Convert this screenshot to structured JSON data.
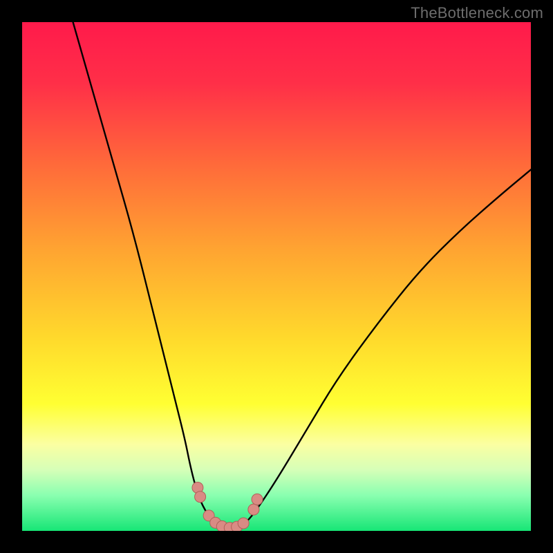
{
  "watermark": "TheBottleneck.com",
  "colors": {
    "frame": "#000000",
    "gradient_stops": [
      {
        "offset": 0.0,
        "color": "#ff1a4b"
      },
      {
        "offset": 0.12,
        "color": "#ff2f48"
      },
      {
        "offset": 0.28,
        "color": "#ff6a3a"
      },
      {
        "offset": 0.45,
        "color": "#ffa531"
      },
      {
        "offset": 0.62,
        "color": "#ffd92c"
      },
      {
        "offset": 0.75,
        "color": "#ffff32"
      },
      {
        "offset": 0.83,
        "color": "#fbffa2"
      },
      {
        "offset": 0.88,
        "color": "#d6ffb8"
      },
      {
        "offset": 0.93,
        "color": "#8affb0"
      },
      {
        "offset": 1.0,
        "color": "#17e676"
      }
    ],
    "curve_stroke": "#000000",
    "marker_fill": "#d98b84",
    "marker_stroke": "#b06058"
  },
  "chart_data": {
    "type": "line",
    "title": "",
    "xlabel": "",
    "ylabel": "",
    "xlim": [
      0,
      100
    ],
    "ylim": [
      0,
      100
    ],
    "series": [
      {
        "name": "left-branch",
        "x": [
          10,
          14,
          18,
          22,
          26,
          28,
          30,
          32,
          33,
          34,
          35,
          36,
          37,
          38
        ],
        "y": [
          100,
          86,
          72,
          58,
          42,
          34,
          26,
          18,
          13,
          9,
          6,
          4,
          2.5,
          1.5
        ]
      },
      {
        "name": "valley",
        "x": [
          38,
          39,
          40,
          41,
          42,
          43,
          44
        ],
        "y": [
          1.5,
          0.9,
          0.6,
          0.5,
          0.6,
          0.9,
          1.6
        ]
      },
      {
        "name": "right-branch",
        "x": [
          44,
          46,
          50,
          56,
          62,
          70,
          78,
          86,
          94,
          100
        ],
        "y": [
          1.6,
          4,
          10,
          20,
          30,
          41,
          51,
          59,
          66,
          71
        ]
      }
    ],
    "markers": {
      "name": "valley-markers",
      "points": [
        {
          "x": 34.5,
          "y": 8.5
        },
        {
          "x": 35.0,
          "y": 6.7
        },
        {
          "x": 36.7,
          "y": 3.0
        },
        {
          "x": 38.0,
          "y": 1.6
        },
        {
          "x": 39.3,
          "y": 0.9
        },
        {
          "x": 40.8,
          "y": 0.6
        },
        {
          "x": 42.2,
          "y": 0.8
        },
        {
          "x": 43.5,
          "y": 1.5
        },
        {
          "x": 45.5,
          "y": 4.2
        },
        {
          "x": 46.2,
          "y": 6.2
        }
      ],
      "radius_px": 8
    }
  }
}
